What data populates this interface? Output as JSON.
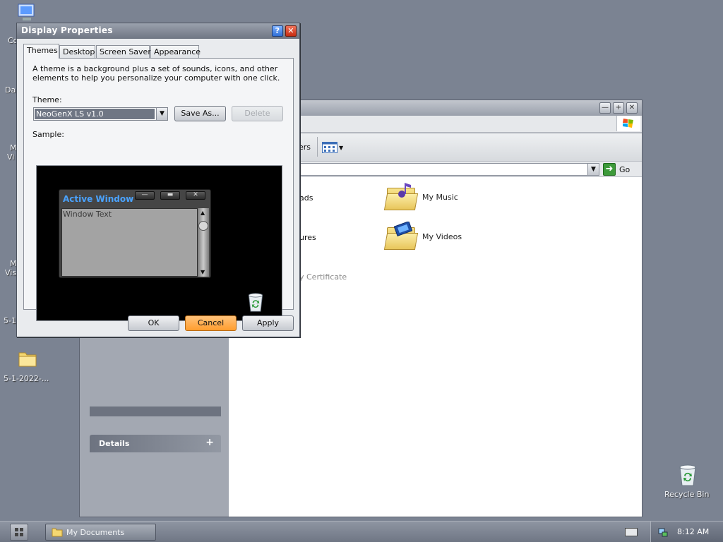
{
  "desktop": {
    "icons": [
      {
        "label": "Co",
        "icon": "computer-icon"
      },
      {
        "label": "Da",
        "icon": "folder-icon"
      },
      {
        "label": "M",
        "label2": "Vi",
        "icon": "app-icon"
      },
      {
        "label": "M",
        "label2": "Vis",
        "icon": "app-icon"
      },
      {
        "label": "5-1",
        "icon": "folder-icon"
      },
      {
        "label": "5-1-2022-...",
        "icon": "folder-icon"
      }
    ],
    "recycle_bin": "Recycle Bin"
  },
  "explorer": {
    "toolbar_partial": "ers",
    "go_label": "Go",
    "items": [
      {
        "label": "ads",
        "icon": "folder-icon"
      },
      {
        "label": "My Music",
        "icon": "music-folder-icon"
      },
      {
        "label": "ures",
        "icon": "folder-icon"
      },
      {
        "label": "My Videos",
        "icon": "video-folder-icon"
      },
      {
        "label": "y Certificate",
        "icon": "certificate-icon"
      }
    ],
    "details_label": "Details",
    "details_toggle": "+"
  },
  "dialog": {
    "title": "Display Properties",
    "tabs": [
      {
        "label": "Themes",
        "active": true
      },
      {
        "label": "Desktop",
        "active": false
      },
      {
        "label": "Screen Saver",
        "active": false
      },
      {
        "label": "Appearance",
        "active": false
      }
    ],
    "description": "A theme is a background plus a set of sounds, icons, and other elements to help you personalize your computer with one click.",
    "theme_label": "Theme:",
    "theme_value": "NeoGenX LS v1.0",
    "save_as_label": "Save As...",
    "delete_label": "Delete",
    "sample_label": "Sample:",
    "sample_window_title": "Active Window",
    "sample_window_text": "Window Text",
    "ok_label": "OK",
    "cancel_label": "Cancel",
    "apply_label": "Apply"
  },
  "taskbar": {
    "task_label": "My Documents",
    "clock": "8:12 AM"
  },
  "colors": {
    "desktop": "#7b8392",
    "accent_orange": "#ff9d2e",
    "sample_title": "#4aa3ff"
  }
}
